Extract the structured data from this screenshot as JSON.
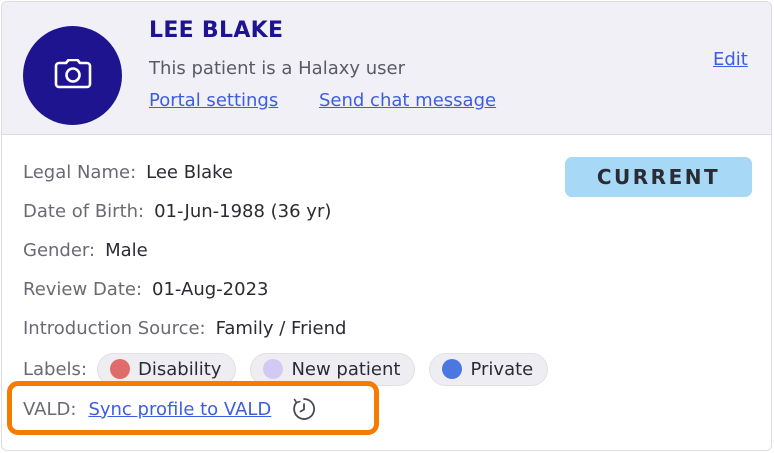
{
  "header": {
    "name": "LEE BLAKE",
    "subtitle": "This patient is a Halaxy user",
    "portal_link": "Portal settings",
    "chat_link": "Send chat message",
    "edit_link": "Edit",
    "avatar_icon": "camera-icon"
  },
  "status": "CURRENT",
  "details": {
    "legal_name_label": "Legal Name:",
    "legal_name": "Lee Blake",
    "dob_label": "Date of Birth:",
    "dob": "01-Jun-1988 (36 yr)",
    "gender_label": "Gender:",
    "gender": "Male",
    "review_label": "Review Date:",
    "review": "01-Aug-2023",
    "source_label": "Introduction Source:",
    "source": "Family / Friend",
    "labels_label": "Labels:",
    "labels": [
      {
        "text": "Disability",
        "color": "#e06b6b"
      },
      {
        "text": "New patient",
        "color": "#d4c9f5"
      },
      {
        "text": "Private",
        "color": "#4a78e0"
      }
    ],
    "vald_label": "VALD:",
    "vald_link": "Sync profile to VALD",
    "vald_icon": "clock-icon"
  },
  "colors": {
    "brand": "#1e1490",
    "link": "#3d5de0",
    "badge": "#a7d8f5",
    "highlight": "#f57c00"
  }
}
